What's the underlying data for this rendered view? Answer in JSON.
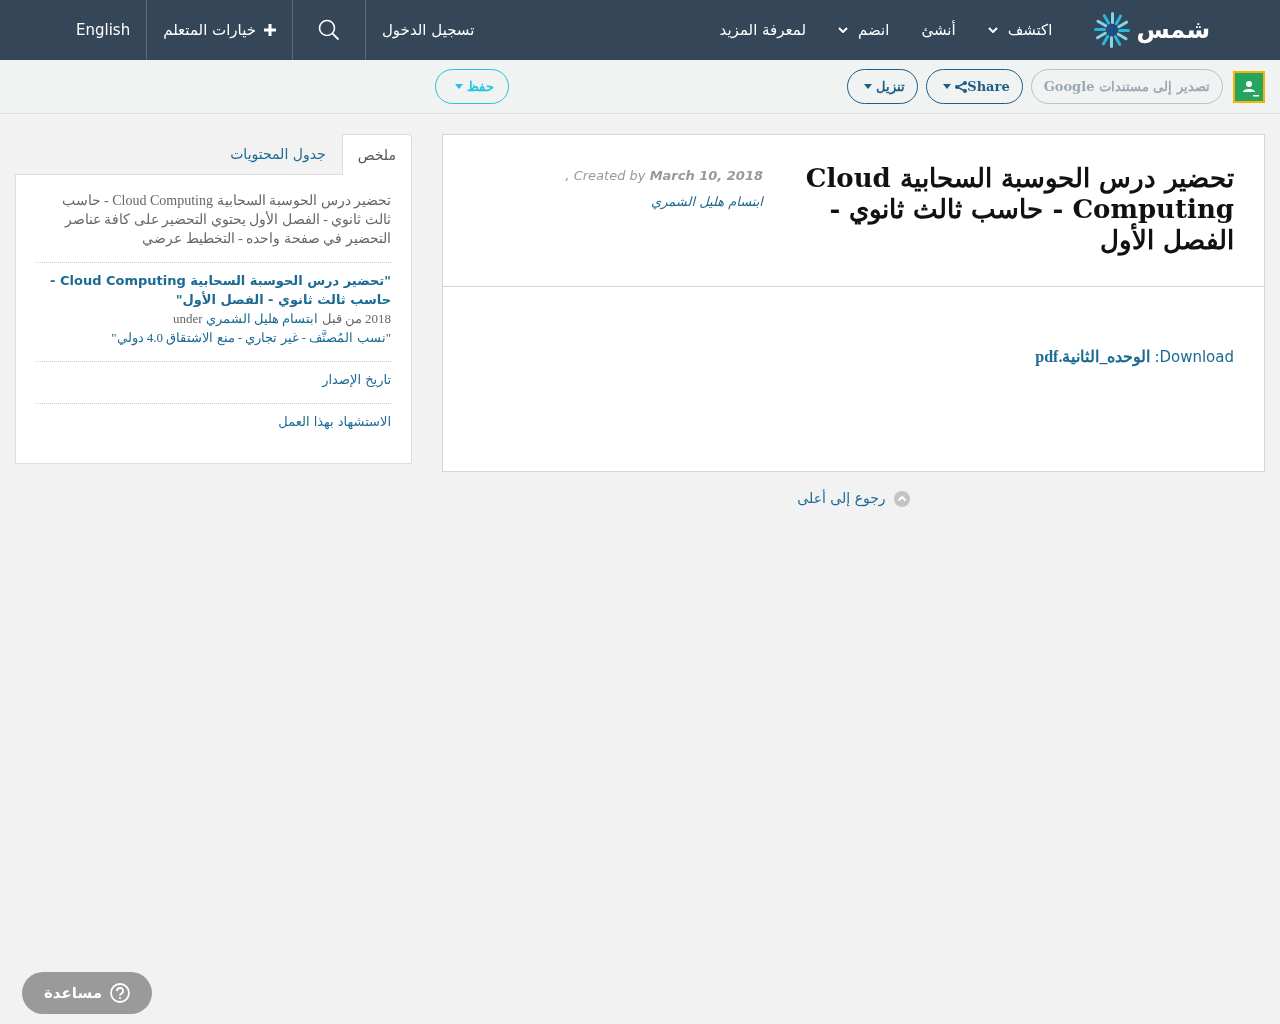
{
  "navbar": {
    "logo_text": "شمس",
    "items": [
      {
        "label": "اكتشف",
        "dropdown": true
      },
      {
        "label": "أنشئ",
        "dropdown": false
      },
      {
        "label": "انضم",
        "dropdown": true
      },
      {
        "label": "لمعرفة المزيد",
        "dropdown": false
      }
    ],
    "login": "تسجيل الدخول",
    "learner_options": "خيارات المتعلم",
    "language": "English"
  },
  "toolbar": {
    "google_export": {
      "label": "تصدير إلى مستندات Google",
      "disabled": true
    },
    "share": "Share",
    "download": "تنزيل",
    "save": "حفظ"
  },
  "article": {
    "title": "تحضير درس الحوسبة السحابية Cloud Computing - حاسب ثالث ثانوي - الفصل الأول",
    "byline": {
      "by": "by",
      "date": "March 10, 2018",
      "created": ", Created",
      "author": "ابتسام هليل الشمري"
    },
    "download_label": "Download:",
    "download_file": "الوحده_الثانية.pdf"
  },
  "sidebar": {
    "tabs": [
      {
        "label": "ملخص",
        "selected": true
      },
      {
        "label": "جدول المحتويات",
        "selected": false
      }
    ],
    "summary": "تحضير درس الحوسبة السحابية Cloud Computing - حاسب ثالث ثانوي - الفصل الأول يحتوي التحضير على كافة عناصر التحضير في صفحة واحده - التخطيط عرضي",
    "citation": {
      "title": "\"تحضير درس الحوسبة السحابية Cloud Computing - حاسب ثالث ثانوي - الفصل الأول\"",
      "year": "2018 من قبل",
      "author": "ابتسام هليل الشمري",
      "under": "under",
      "license": "\"نسب المُصنَّف - غير تجاري - منع الاشتقاق 4.0 دولي\""
    },
    "links": [
      "تاريخ الإصدار",
      "الاستشهاد بهذا العمل"
    ]
  },
  "back_to_top": "رجوع إلى أعلى",
  "help": "مساعدة"
}
